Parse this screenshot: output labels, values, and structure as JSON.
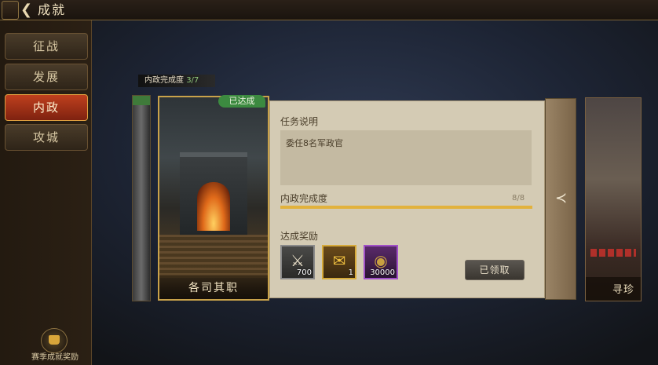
{
  "header": {
    "title": "成就",
    "back_glyph": "❮"
  },
  "sidebar": {
    "tabs": [
      {
        "label": "征战",
        "active": false
      },
      {
        "label": "发展",
        "active": false
      },
      {
        "label": "内政",
        "active": true
      },
      {
        "label": "攻城",
        "active": false
      }
    ],
    "season_reward_label": "赛季成就奖励"
  },
  "progress": {
    "label": "内政完成度",
    "count": "3/7"
  },
  "card": {
    "name": "各司其职",
    "badge": "已达成"
  },
  "next_card": {
    "name": "寻珍"
  },
  "detail": {
    "task_title": "任务说明",
    "task_desc": "委任8名军政官",
    "progress_label": "内政完成度",
    "progress_value": "8/8",
    "progress_fraction": 1.0,
    "rewards_title": "达成奖励",
    "rewards": [
      {
        "icon": "crossed-swords-icon",
        "glyph": "⚔",
        "qty": "700"
      },
      {
        "icon": "scroll-icon",
        "glyph": "✉",
        "qty": "1"
      },
      {
        "icon": "coin-icon",
        "glyph": "◉",
        "qty": "30000"
      }
    ],
    "claimed_label": "已领取"
  },
  "collapse_glyph": "≺"
}
